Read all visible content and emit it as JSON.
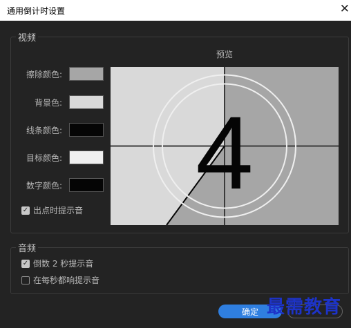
{
  "window": {
    "title": "通用倒计时设置",
    "close_glyph": "✕"
  },
  "video_group": {
    "label": "视频",
    "preview_title": "预览",
    "preview_number": "4",
    "colors": [
      {
        "label": "擦除颜色:",
        "color": "#a6a6a6"
      },
      {
        "label": "背景色:",
        "color": "#d9d9d9"
      },
      {
        "label": "线条颜色:",
        "color": "#050505"
      },
      {
        "label": "目标颜色:",
        "color": "#efefef"
      },
      {
        "label": "数字颜色:",
        "color": "#050505"
      }
    ],
    "cue_checkbox": {
      "label": "出点时提示音",
      "checked": true
    }
  },
  "audio_group": {
    "label": "音频",
    "options": [
      {
        "label": "倒数 2 秒提示音",
        "checked": true
      },
      {
        "label": "在每秒都响提示音",
        "checked": false
      }
    ]
  },
  "buttons": {
    "ok": "确定"
  },
  "watermark": "最需教育"
}
